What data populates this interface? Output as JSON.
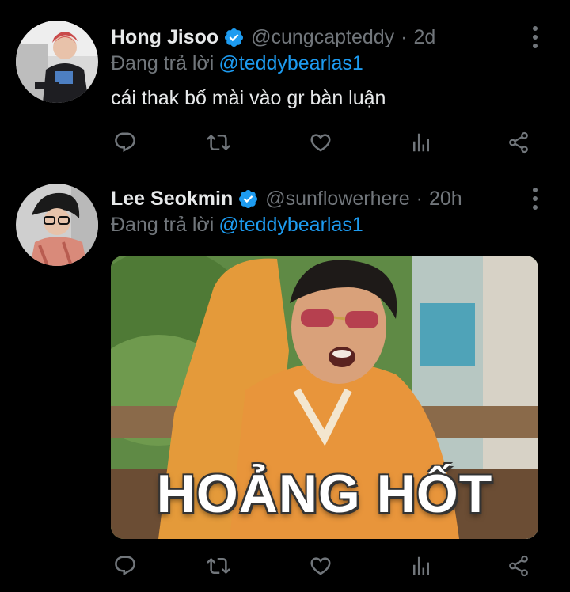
{
  "colors": {
    "background": "#000000",
    "text_primary": "#e7e9ea",
    "text_secondary": "#71767b",
    "accent_blue": "#1d9bf0",
    "divider": "#2f3336"
  },
  "tweets": [
    {
      "display_name": "Hong Jisoo",
      "verified": true,
      "handle": "@cungcapteddy",
      "separator": "·",
      "time": "2d",
      "reply_prefix": "Đang trả lời",
      "reply_to": "@teddybearlas1",
      "text": "cái thak bố mài vào gr bàn luận",
      "icons": {
        "avatar": "profile-photo",
        "more": "more-vertical-icon",
        "reply": "reply-icon",
        "retweet": "retweet-icon",
        "like": "heart-icon",
        "views": "analytics-icon",
        "share": "share-icon"
      }
    },
    {
      "display_name": "Lee Seokmin",
      "verified": true,
      "handle": "@sunflowerhere",
      "separator": "·",
      "time": "20h",
      "reply_prefix": "Đang trả lời",
      "reply_to": "@teddybearlas1",
      "media": {
        "caption": "HOẢNG HỐT"
      },
      "icons": {
        "avatar": "profile-photo",
        "more": "more-vertical-icon",
        "reply": "reply-icon",
        "retweet": "retweet-icon",
        "like": "heart-icon",
        "views": "analytics-icon",
        "share": "share-icon"
      }
    }
  ]
}
